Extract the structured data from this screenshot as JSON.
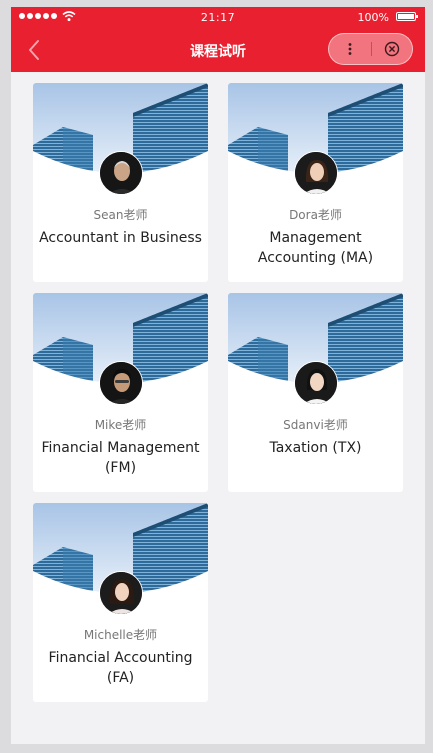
{
  "statusbar": {
    "time": "21:17",
    "battery": "100%",
    "battery_level": 1.0
  },
  "navbar": {
    "title": "课程试听",
    "back_icon": "chevron-left-icon",
    "more_icon": "more-vertical-icon",
    "close_icon": "close-circle-icon"
  },
  "theme": {
    "primary": "#e8202f",
    "background": "#f2f2f4",
    "card": "#ffffff"
  },
  "courses": [
    {
      "teacher": "Sean老师",
      "title": "Accountant in Business"
    },
    {
      "teacher": "Dora老师",
      "title": "Management Accounting (MA)"
    },
    {
      "teacher": "Mike老师",
      "title": "Financial Management (FM)"
    },
    {
      "teacher": "Sdanvi老师",
      "title": "Taxation (TX)"
    },
    {
      "teacher": "Michelle老师",
      "title": "Financial Accounting (FA)"
    }
  ]
}
